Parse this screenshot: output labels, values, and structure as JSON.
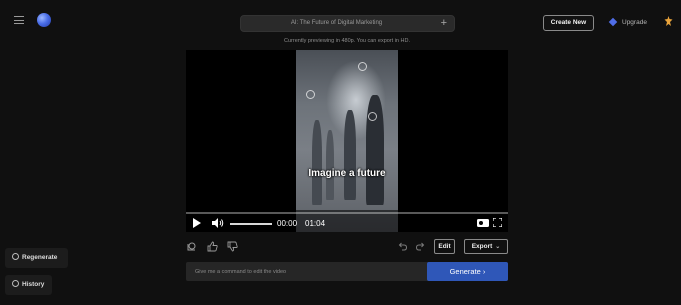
{
  "project": {
    "title": "AI: The Future of Digital Marketing"
  },
  "header": {
    "create_new_label": "Create New",
    "upgrade_label": "Upgrade",
    "preview_note": "Currently previewing in 480p. You can export in HD."
  },
  "player": {
    "caption": "Imagine a future",
    "current_time": "00:00",
    "total_time": "01:04",
    "progress": 0,
    "volume": 1
  },
  "actions": {
    "edit_label": "Edit",
    "export_label": "Export"
  },
  "command": {
    "placeholder": "Give me a command to edit the video",
    "generate_label": "Generate ›"
  },
  "sidebar": {
    "regenerate_label": "Regenerate",
    "history_label": "History"
  },
  "colors": {
    "background": "#101010",
    "accent": "#2f57b8",
    "brand_globe": "#4a6ee8"
  }
}
